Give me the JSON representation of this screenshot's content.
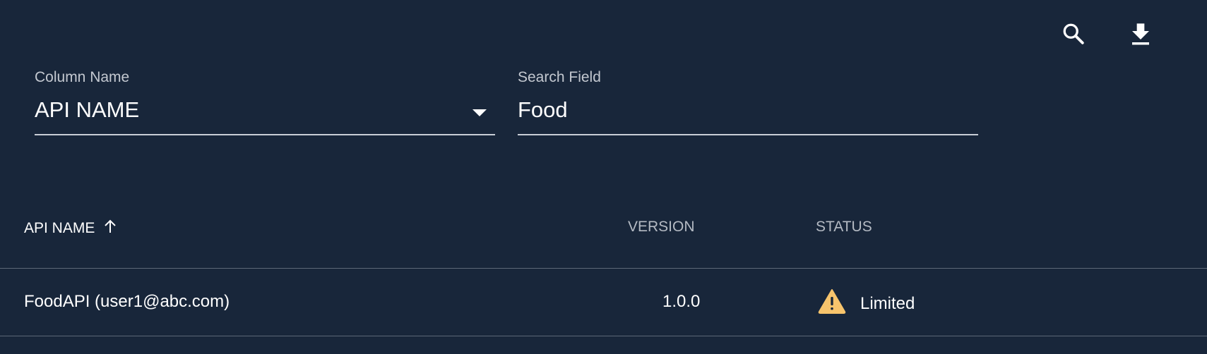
{
  "toolbar": {
    "search_icon": "search-icon",
    "download_icon": "download-icon"
  },
  "filters": {
    "column_name": {
      "label": "Column Name",
      "value": "API NAME"
    },
    "search_field": {
      "label": "Search Field",
      "value": "Food"
    }
  },
  "table": {
    "columns": [
      {
        "label": "API NAME",
        "sort": "ascending"
      },
      {
        "label": "VERSION"
      },
      {
        "label": "STATUS"
      }
    ],
    "rows": [
      {
        "api_name": "FoodAPI (user1@abc.com)",
        "version": "1.0.0",
        "status": "Limited",
        "status_icon": "warning-icon"
      }
    ]
  },
  "colors": {
    "background": "#18263a",
    "warning": "#f7c46c",
    "divider": "#5c6777"
  }
}
